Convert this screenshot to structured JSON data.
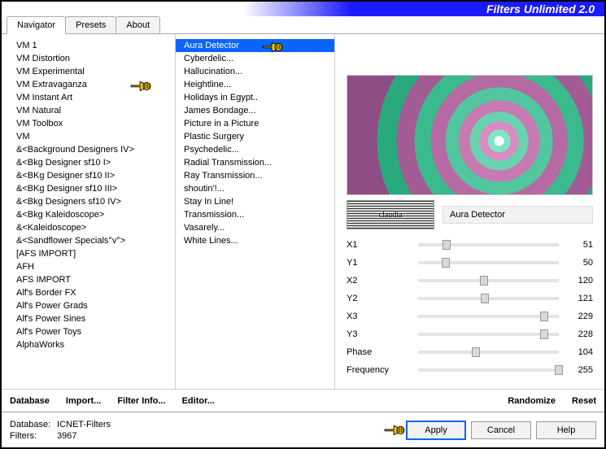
{
  "header": {
    "title": "Filters Unlimited 2.0"
  },
  "tabs": [
    {
      "label": "Navigator",
      "active": true
    },
    {
      "label": "Presets",
      "active": false
    },
    {
      "label": "About",
      "active": false
    }
  ],
  "categories": [
    "VM 1",
    "VM Distortion",
    "VM Experimental",
    "VM Extravaganza",
    "VM Instant Art",
    "VM Natural",
    "VM Toolbox",
    "VM",
    "&<Background Designers IV>",
    "&<Bkg Designer sf10 I>",
    "&<BKg Designer sf10 II>",
    "&<BKg Designer sf10 III>",
    "&<Bkg Designers sf10 IV>",
    "&<Bkg Kaleidoscope>",
    "&<Kaleidoscope>",
    "&<Sandflower Specials°v°>",
    "[AFS IMPORT]",
    "AFH",
    "AFS IMPORT",
    "Alf's Border FX",
    "Alf's Power Grads",
    "Alf's Power Sines",
    "Alf's Power Toys",
    "AlphaWorks"
  ],
  "categories_highlight_index": 3,
  "filters": [
    "Aura Detector",
    "Cyberdelic...",
    "Hallucination...",
    "Heightline...",
    "Holidays in Egypt..",
    "James Bondage...",
    "Picture in a Picture",
    "Plastic Surgery",
    "Psychedelic...",
    "Radial Transmission...",
    "Ray Transmission...",
    "shoutin'!...",
    "Stay In Line!",
    "Transmission...",
    "Vasarely...",
    "White Lines..."
  ],
  "filters_selected_index": 0,
  "current_filter_name": "Aura Detector",
  "params": [
    {
      "name": "X1",
      "value": 51,
      "max": 255
    },
    {
      "name": "Y1",
      "value": 50,
      "max": 255
    },
    {
      "name": "X2",
      "value": 120,
      "max": 255
    },
    {
      "name": "Y2",
      "value": 121,
      "max": 255
    },
    {
      "name": "X3",
      "value": 229,
      "max": 255
    },
    {
      "name": "Y3",
      "value": 228,
      "max": 255
    },
    {
      "name": "Phase",
      "value": 104,
      "max": 255
    },
    {
      "name": "Frequency",
      "value": 255,
      "max": 255
    }
  ],
  "toolbar": {
    "database": "Database",
    "import": "Import...",
    "filter_info": "Filter Info...",
    "editor": "Editor...",
    "randomize": "Randomize",
    "reset": "Reset"
  },
  "footer": {
    "database_label": "Database:",
    "database_value": "ICNET-Filters",
    "filters_label": "Filters:",
    "filters_value": "3967",
    "apply": "Apply",
    "cancel": "Cancel",
    "help": "Help"
  },
  "logo_text": "claudia"
}
